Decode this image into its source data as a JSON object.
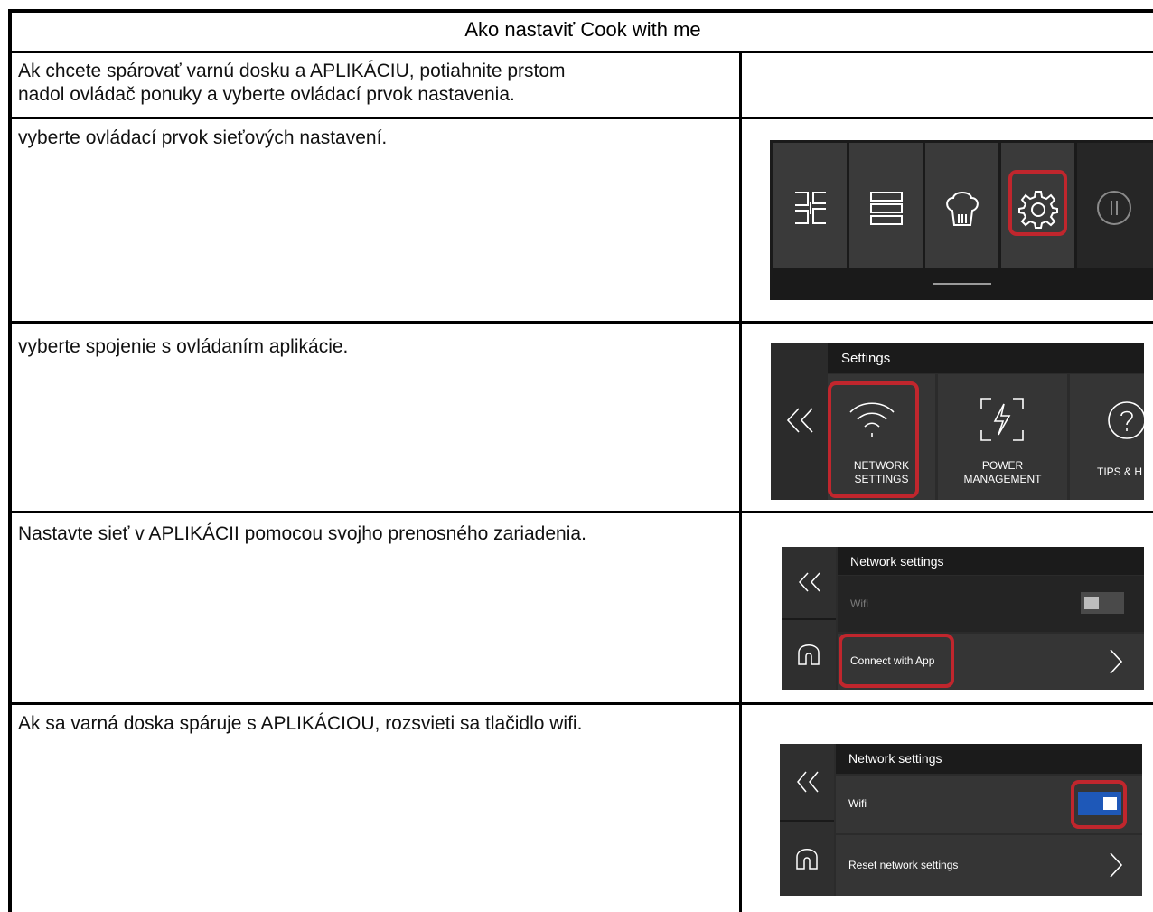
{
  "document": {
    "title": "Ako nastaviť Cook with me",
    "rows": [
      {
        "text_lines": [
          "Ak chcete spárovať varnú dosku a APLIKÁCIU, potiahnite prstom",
          "nadol ovládač ponuky a vyberte ovládací prvok nastavenia."
        ]
      },
      {
        "text_lines": [
          "vyberte ovládací prvok sieťových nastavení."
        ]
      },
      {
        "text_lines": [
          "vyberte spojenie s ovládaním aplikácie."
        ]
      },
      {
        "text_lines": [
          "Nastavte sieť v APLIKÁCII pomocou svojho prenosného zariadenia."
        ]
      },
      {
        "text_lines": [
          "Ak sa varná doska spáruje s APLIKÁCIOU, rozsvieti sa tlačidlo wifi."
        ]
      }
    ]
  },
  "screens": {
    "menu_bar": {
      "icons": [
        "hob-zones-icon",
        "layers-icon",
        "chef-hat-icon",
        "gear-icon",
        "pause-icon"
      ],
      "highlighted": "gear-icon"
    },
    "settings": {
      "title": "Settings",
      "back_icon": "double-chevron-left-icon",
      "tiles": [
        {
          "icon": "wifi-icon",
          "label_line1": "NETWORK",
          "label_line2": "SETTINGS"
        },
        {
          "icon": "power-bolt-icon",
          "label_line1": "POWER",
          "label_line2": "MANAGEMENT"
        },
        {
          "icon": "question-icon",
          "label_line1": "TIPS & H"
        }
      ],
      "highlighted": "network-settings"
    },
    "network_off": {
      "title": "Network settings",
      "wifi_label": "Wifi",
      "wifi_on": false,
      "connect_label": "Connect with App"
    },
    "network_on": {
      "title": "Network settings",
      "wifi_label": "Wifi",
      "wifi_on": true,
      "reset_label": "Reset network settings"
    },
    "colors": {
      "highlight": "#c0262d",
      "toggle_on": "#1e58b8",
      "panel": "#2b2b2b"
    }
  }
}
